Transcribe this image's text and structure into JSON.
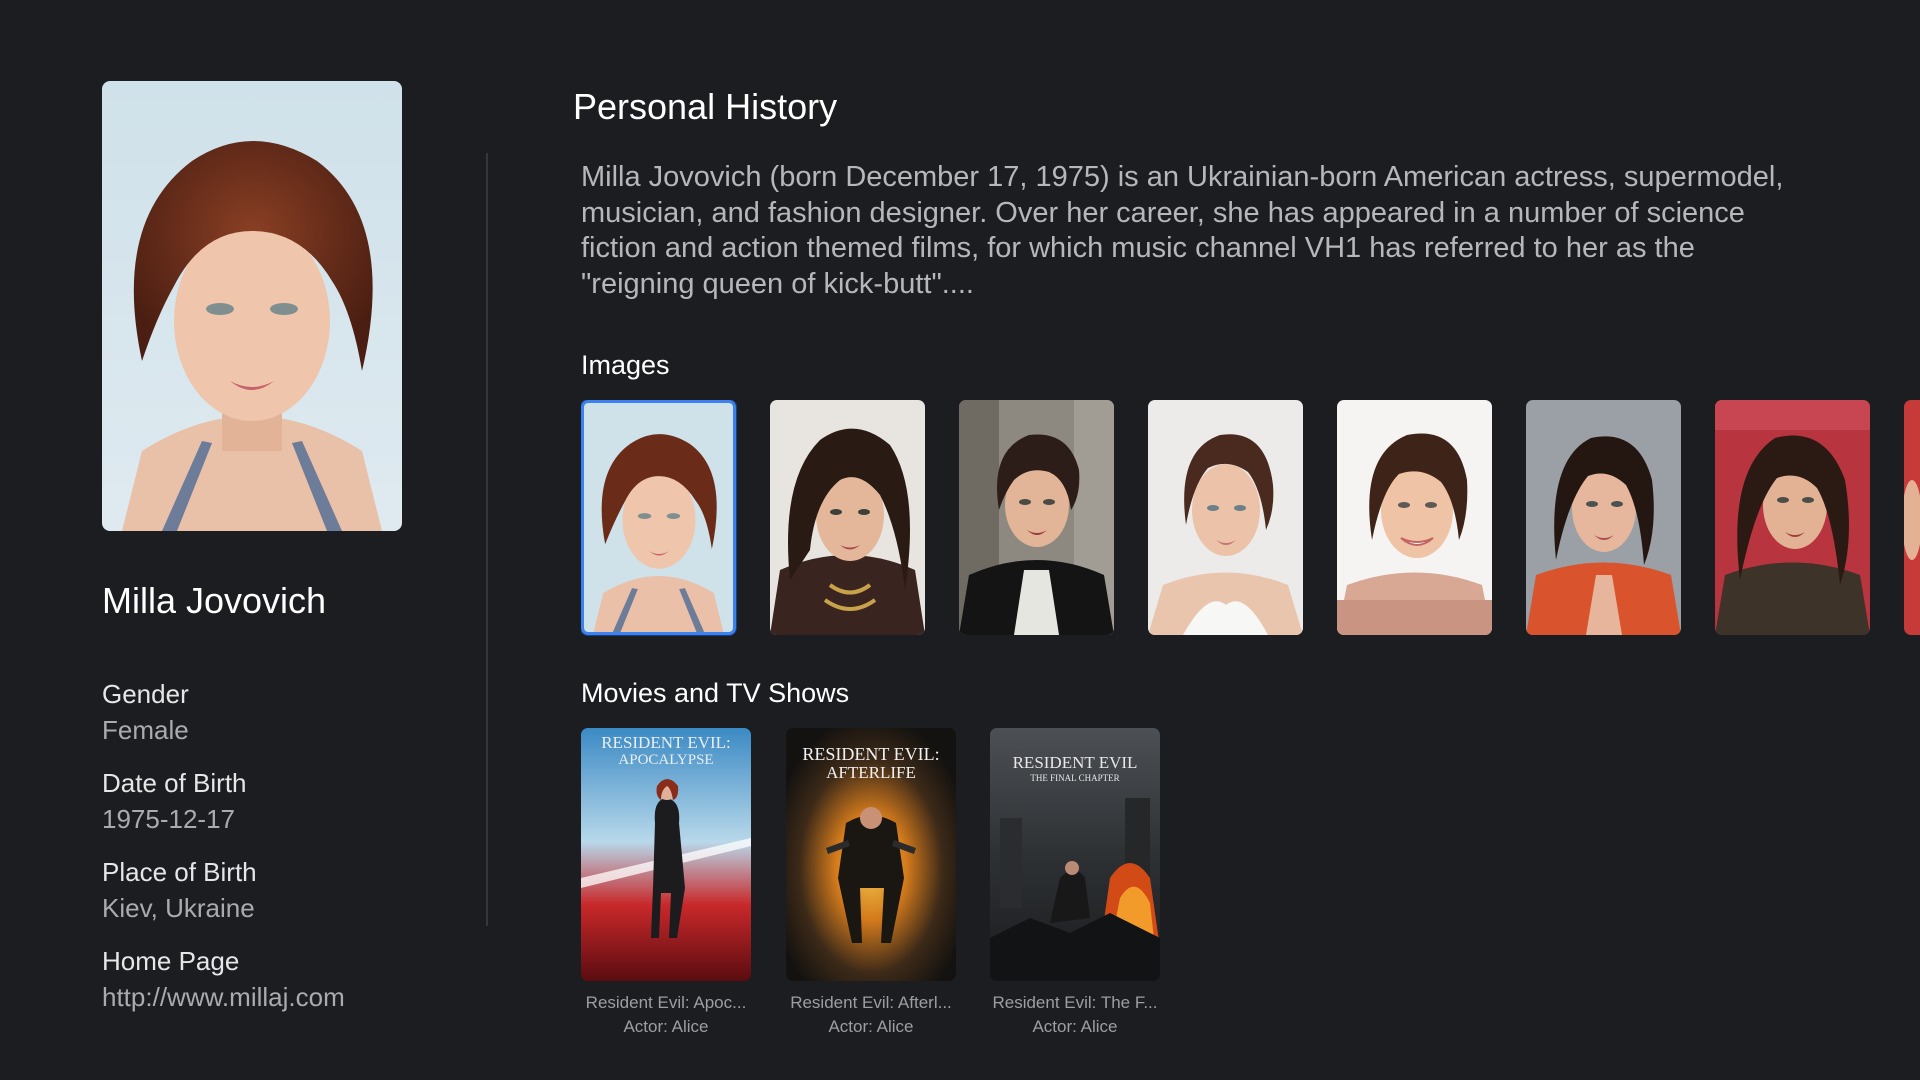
{
  "person": {
    "name": "Milla Jovovich",
    "facts": [
      {
        "label": "Gender",
        "value": "Female"
      },
      {
        "label": "Date of Birth",
        "value": "1975-12-17"
      },
      {
        "label": "Place of Birth",
        "value": "Kiev, Ukraine"
      },
      {
        "label": "Home Page",
        "value": "http://www.millaj.com"
      }
    ]
  },
  "history": {
    "title": "Personal History",
    "biography": "Milla Jovovich (born December 17, 1975) is an Ukrainian-born American actress, supermodel, musician, and fashion designer. Over her career, she has appeared in a number of science fiction and action themed films, for which music channel VH1 has referred to her as the \"reigning queen of kick-butt\"...."
  },
  "images": {
    "label": "Images",
    "selected_index": 0
  },
  "movies": {
    "label": "Movies and TV Shows",
    "items": [
      {
        "title": "Resident Evil: Apoc...",
        "role": "Actor: Alice",
        "poster_line1": "RESIDENT EVIL:",
        "poster_line2": "APOCALYPSE"
      },
      {
        "title": "Resident Evil: Afterl...",
        "role": "Actor: Alice",
        "poster_line1": "RESIDENT EVIL:",
        "poster_line2": "AFTERLIFE"
      },
      {
        "title": "Resident Evil: The F...",
        "role": "Actor: Alice",
        "poster_line1": "RESIDENT EVIL",
        "poster_line2": "THE FINAL CHAPTER"
      }
    ]
  },
  "colors": {
    "background": "#1b1d21",
    "selection": "#3b82f0",
    "muted_text": "#a9abae"
  }
}
